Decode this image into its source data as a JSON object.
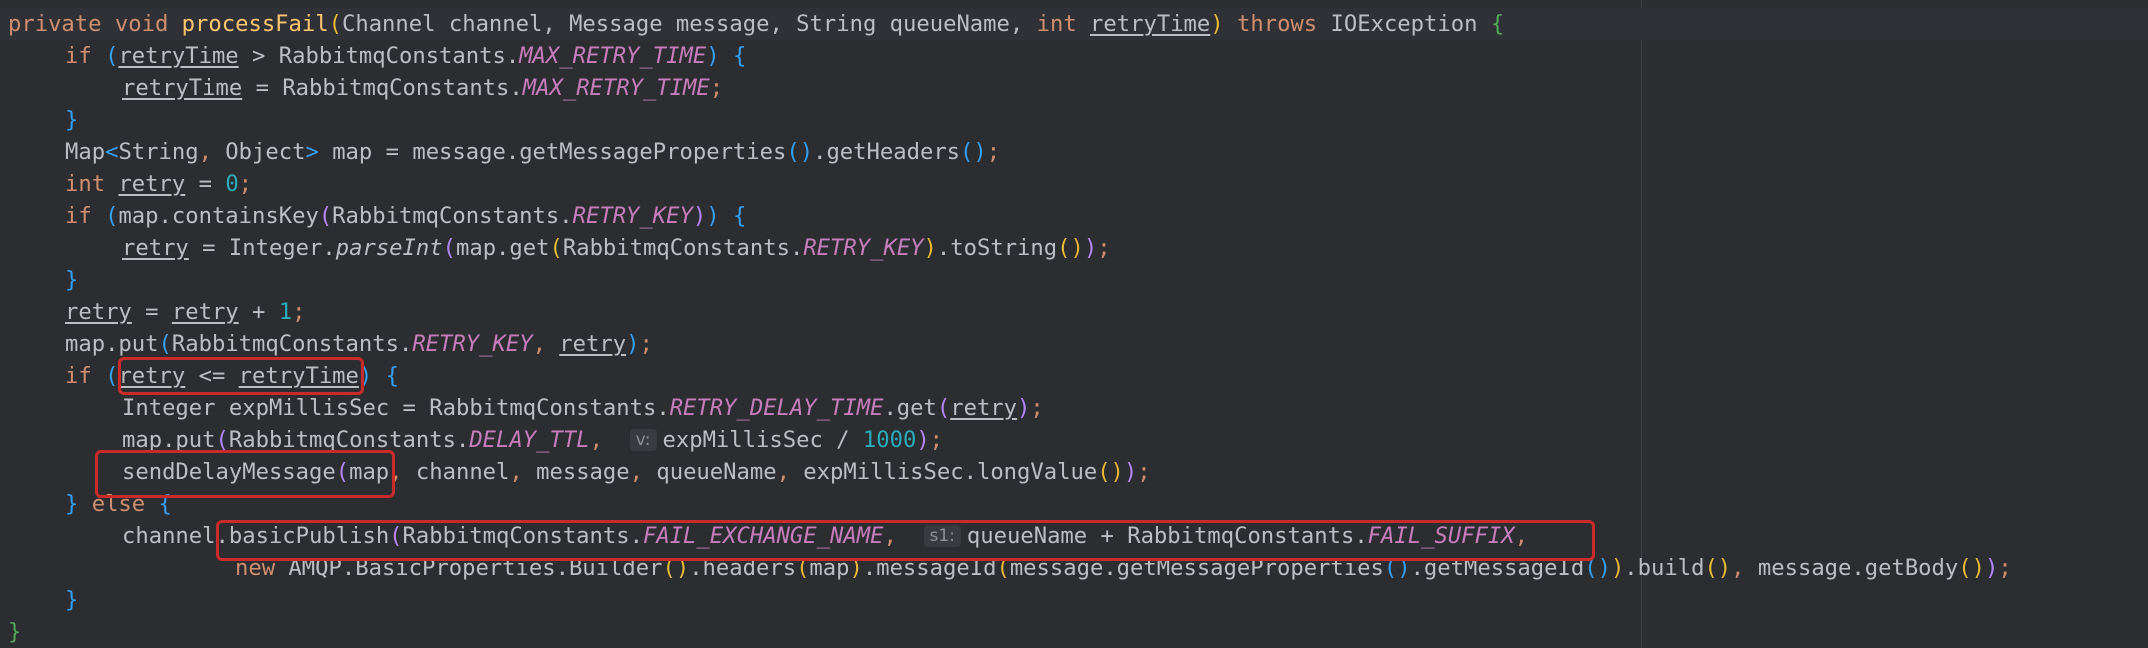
{
  "code": {
    "kw_private": "private",
    "kw_void": "void",
    "fn_processFail": "processFail",
    "sig_param_types": "Channel channel, Message message, String queueName, ",
    "kw_int": "int",
    "p_retryTime": "retryTime",
    "kw_throws": "throws",
    "ex_IOException": "IOException",
    "kw_if": "if",
    "kw_else": "else",
    "kw_new": "new",
    "const_MAX_RETRY_TIME": "MAX_RETRY_TIME",
    "const_RETRY_KEY": "RETRY_KEY",
    "const_RETRY_DELAY_TIME": "RETRY_DELAY_TIME",
    "const_DELAY_TTL": "DELAY_TTL",
    "const_FAIL_EXCHANGE_NAME": "FAIL_EXCHANGE_NAME",
    "const_FAIL_SUFFIX": "FAIL_SUFFIX",
    "cls_RabbitmqConstants": "RabbitmqConstants",
    "v_retry": "retry",
    "v_map": "map",
    "v_expMillisSec": "expMillisSec",
    "num_0": "0",
    "num_1": "1",
    "num_1000": "1000",
    "m_parseInt": "parseInt",
    "hint_v": "v:",
    "hint_s1": "s1:",
    "m_sendDelayMessage": "sendDelayMessage",
    "m_basicPublish": "basicPublish"
  }
}
